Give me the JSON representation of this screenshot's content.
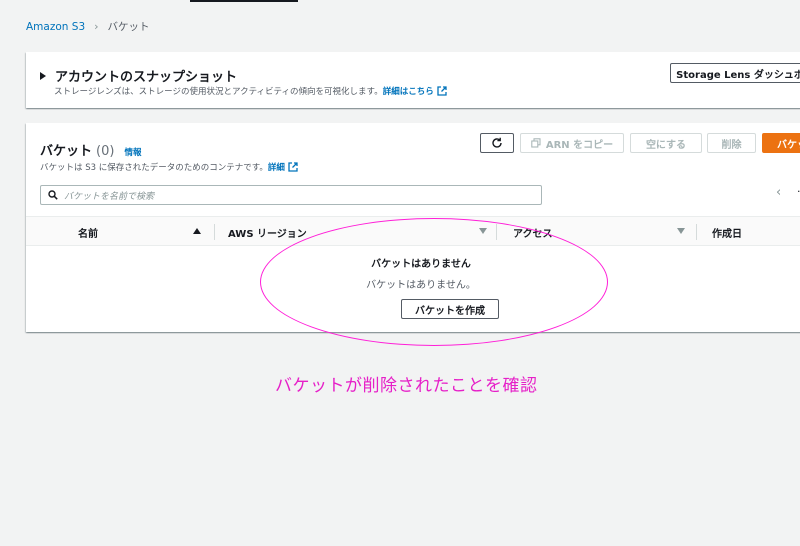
{
  "breadcrumb": {
    "root": "Amazon S3",
    "current": "バケット"
  },
  "snapshot": {
    "title": "アカウントのスナップショット",
    "description": "ストレージレンズは、ストレージの使用状況とアクティビティの傾向を可視化します。",
    "details_link": "詳細はこちら",
    "dashboard_button": "Storage Lens ダッシュボード"
  },
  "buckets": {
    "title": "バケット",
    "count": "(0)",
    "info": "情報",
    "description": "バケットは S3 に保存されたデータのためのコンテナです。",
    "details_link": "詳細",
    "toolbar": {
      "copy_arn": "ARN をコピー",
      "empty": "空にする",
      "delete": "削除",
      "create": "バケットを作成"
    },
    "search_placeholder": "バケットを名前で検索",
    "columns": [
      "名前",
      "AWS リージョン",
      "アクセス",
      "作成日"
    ],
    "empty_state": {
      "title": "バケットはありません",
      "message": "バケットはありません。",
      "button": "バケットを作成"
    }
  },
  "annotation": "バケットが削除されたことを確認",
  "colors": {
    "accent": "#ec7211",
    "link": "#0073bb",
    "annotation": "#e620c8"
  }
}
